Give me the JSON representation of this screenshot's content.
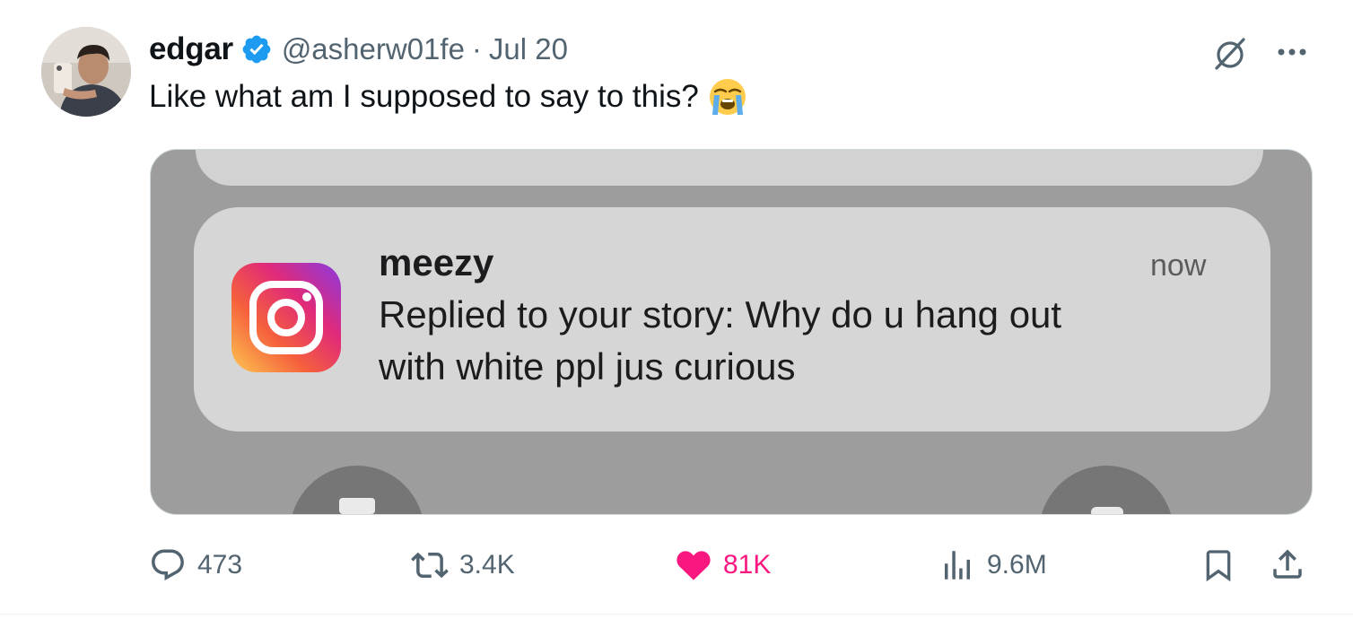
{
  "author": {
    "display_name": "edgar",
    "handle": "@asherw01fe",
    "separator": "·",
    "date": "Jul 20",
    "verified": true
  },
  "tweet": {
    "text": "Like what am I supposed to say to this?",
    "emoji": "loudly-crying-face-icon"
  },
  "media": {
    "notification": {
      "app_icon": "instagram-icon",
      "sender": "meezy",
      "time": "now",
      "line1": "Replied to your story: Why do u hang out",
      "line2": "with white ppl jus curious"
    }
  },
  "actions": {
    "replies": "473",
    "retweets": "3.4K",
    "likes": "81K",
    "views": "9.6M"
  },
  "colors": {
    "text_primary": "#0f1419",
    "text_secondary": "#536471",
    "verified_blue": "#1d9bf0",
    "like_pink": "#f91880",
    "border": "#cfd9de"
  }
}
